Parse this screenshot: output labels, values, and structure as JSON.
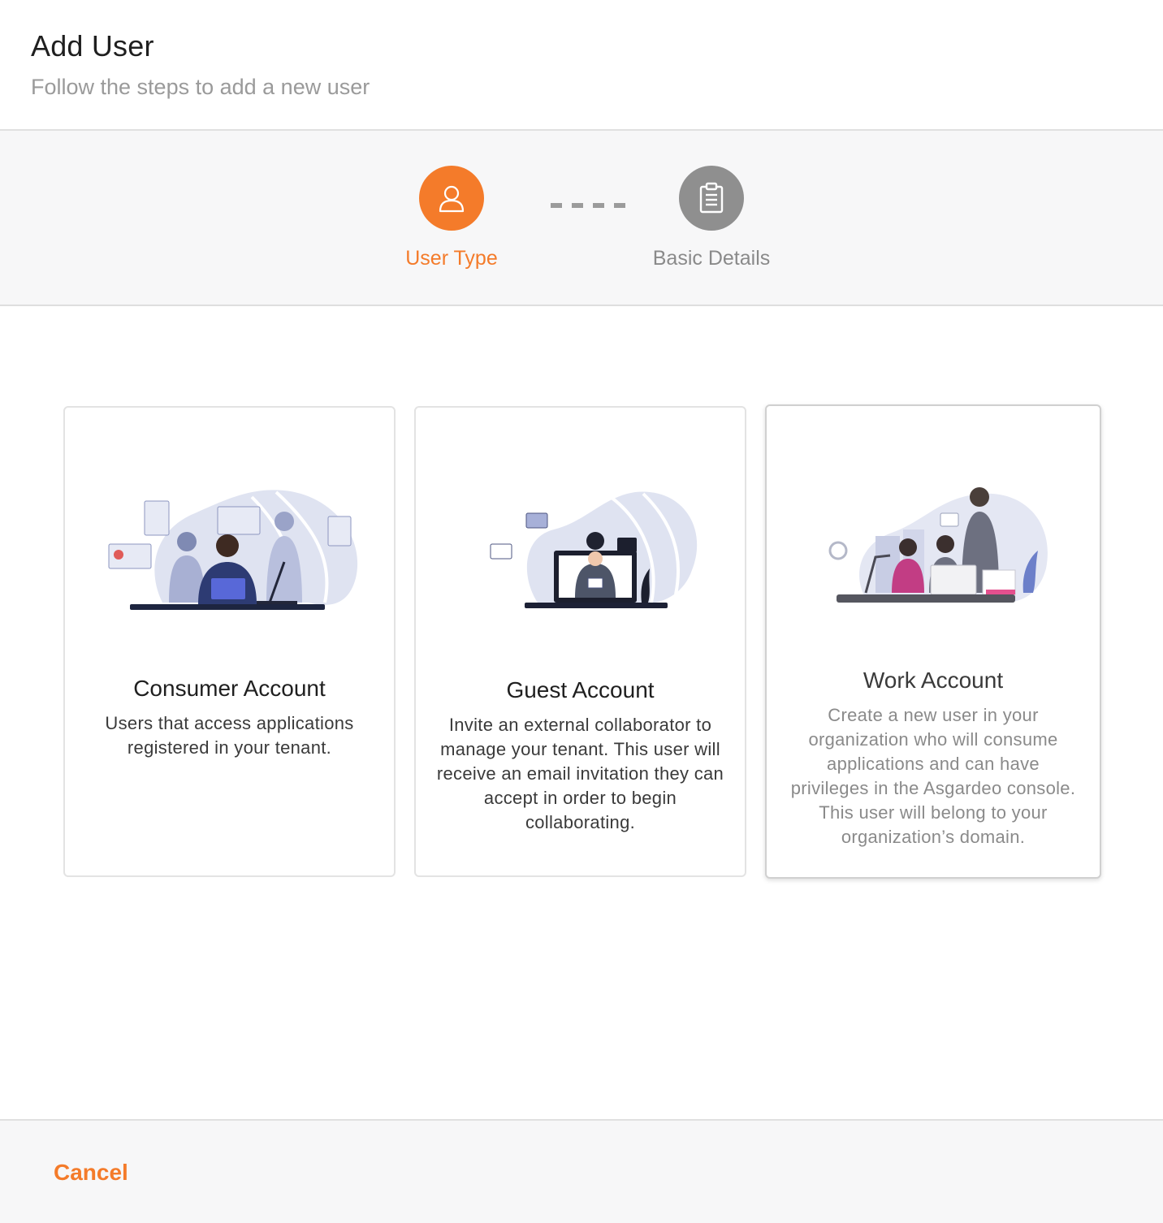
{
  "header": {
    "title": "Add User",
    "subtitle": "Follow the steps to add a new user"
  },
  "stepper": {
    "steps": [
      {
        "label": "User Type",
        "icon": "user-icon",
        "state": "active"
      },
      {
        "label": "Basic Details",
        "icon": "clipboard-icon",
        "state": "pending"
      }
    ]
  },
  "cards": [
    {
      "title": "Consumer Account",
      "description": "Users that access applications registered in your tenant.",
      "illustration": "consumer-illustration"
    },
    {
      "title": "Guest Account",
      "description": "Invite an external collaborator to manage your tenant. This user will receive an email invitation they can accept in order to begin collaborating.",
      "illustration": "guest-illustration"
    },
    {
      "title": "Work Account",
      "description": "Create a new user in your organization who will consume applications and can have privileges in the Asgardeo console. This user will belong to your organization’s domain.",
      "illustration": "work-illustration"
    }
  ],
  "footer": {
    "cancel_label": "Cancel"
  },
  "colors": {
    "accent": "#f47b2a",
    "pending": "#8f8f8f"
  }
}
